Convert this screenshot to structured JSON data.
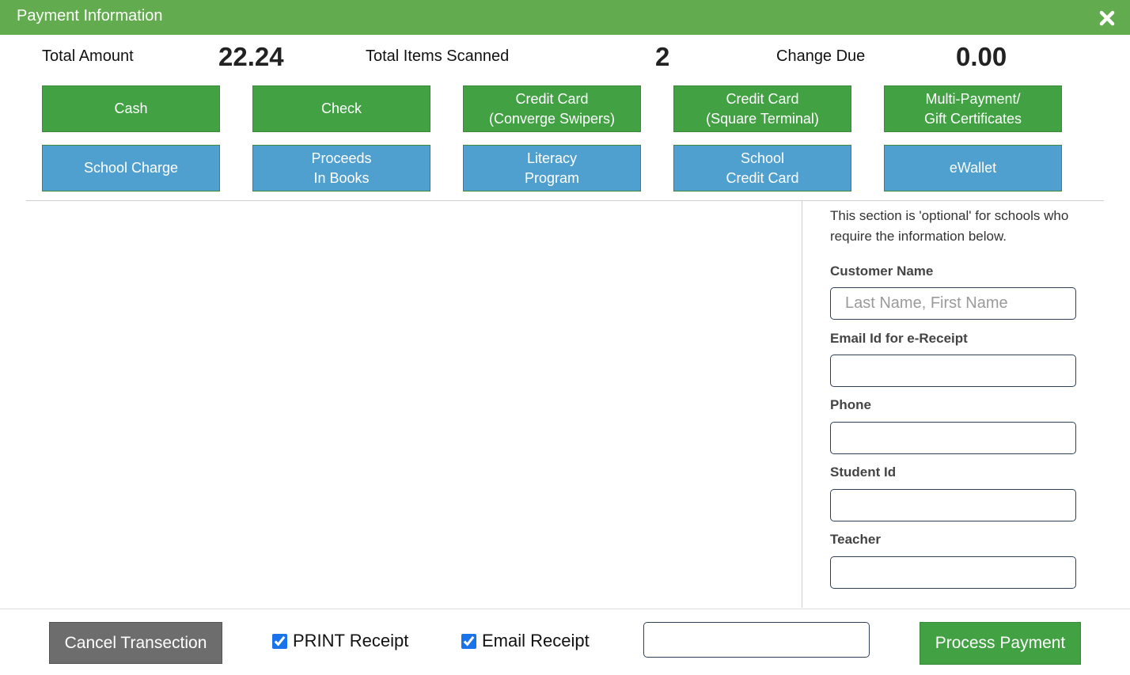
{
  "window": {
    "title": "Payment Information",
    "close_icon": "close-icon"
  },
  "summary": {
    "total_amount_label": "Total Amount",
    "total_amount_value": "22.24",
    "total_items_label": "Total Items Scanned",
    "total_items_value": "2",
    "change_due_label": "Change Due",
    "change_due_value": "0.00"
  },
  "payment_methods": {
    "row1": [
      {
        "label": "Cash"
      },
      {
        "label": "Check"
      },
      {
        "label": "Credit Card\n(Converge Swipers)"
      },
      {
        "label": "Credit Card\n(Square Terminal)"
      },
      {
        "label": "Multi-Payment/\nGift Certificates"
      }
    ],
    "row2": [
      {
        "label": "School Charge"
      },
      {
        "label": "Proceeds\nIn Books"
      },
      {
        "label": "Literacy\nProgram"
      },
      {
        "label": "School\nCredit Card"
      },
      {
        "label": "eWallet"
      }
    ]
  },
  "customer_info": {
    "note": "This section is 'optional' for schools who require the information below.",
    "customer_name_label": "Customer Name",
    "customer_name_placeholder": "Last Name, First Name",
    "customer_name_value": "",
    "email_label": "Email Id for e-Receipt",
    "email_value": "",
    "phone_label": "Phone",
    "phone_value": "",
    "student_id_label": "Student Id",
    "student_id_value": "",
    "teacher_label": "Teacher",
    "teacher_value": ""
  },
  "footer": {
    "cancel_label": "Cancel Transection",
    "print_receipt_label": "PRINT Receipt",
    "print_receipt_checked": true,
    "email_receipt_label": "Email Receipt",
    "email_receipt_checked": true,
    "email_input_value": "",
    "process_label": "Process Payment"
  },
  "colors": {
    "header_green": "#62ab4e",
    "button_green": "#41a143",
    "button_blue": "#4fa0cf",
    "cancel_gray": "#6d6d6d"
  }
}
